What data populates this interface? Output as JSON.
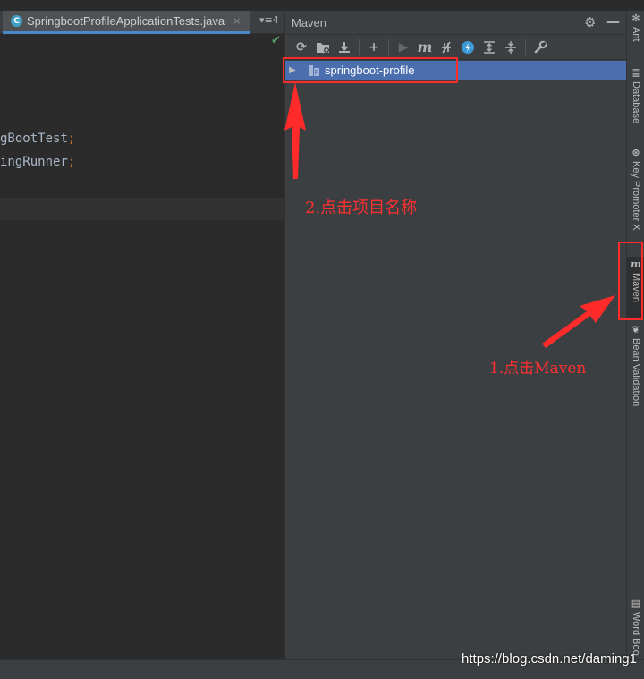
{
  "editor": {
    "tab_label": "SpringbootProfileApplicationTests.java",
    "tab_close": "×",
    "tabs_menu": "▾≡4",
    "code_lines": [
      {
        "text": "gBootTest",
        "semi": ";"
      },
      {
        "text": "ingRunner",
        "semi": ";"
      }
    ]
  },
  "maven": {
    "title": "Maven",
    "toolbar": [
      "reload-icon",
      "add-folder-icon",
      "download-icon",
      "plus-icon",
      "run-icon",
      "maven-goal-icon",
      "toggle-offline-icon",
      "skip-tests-icon",
      "expand-all-icon",
      "collapse-all-icon",
      "settings-wrench-icon"
    ],
    "tree": {
      "project_label": "springboot-profile"
    }
  },
  "annotations": {
    "step2": "2.点击项目名称",
    "step1": "1.点击Maven"
  },
  "right_strip": {
    "tabs": [
      "Ant",
      "Database",
      "Key Promoter X",
      "Maven",
      "Bean Validation",
      "Word Boo"
    ]
  },
  "watermark": "https://blog.csdn.net/daming1",
  "colors": {
    "selection": "#4b6eaf",
    "annotation_red": "#ff2b2b",
    "panel_bg": "#3c3f41",
    "editor_bg": "#2b2b2b"
  }
}
